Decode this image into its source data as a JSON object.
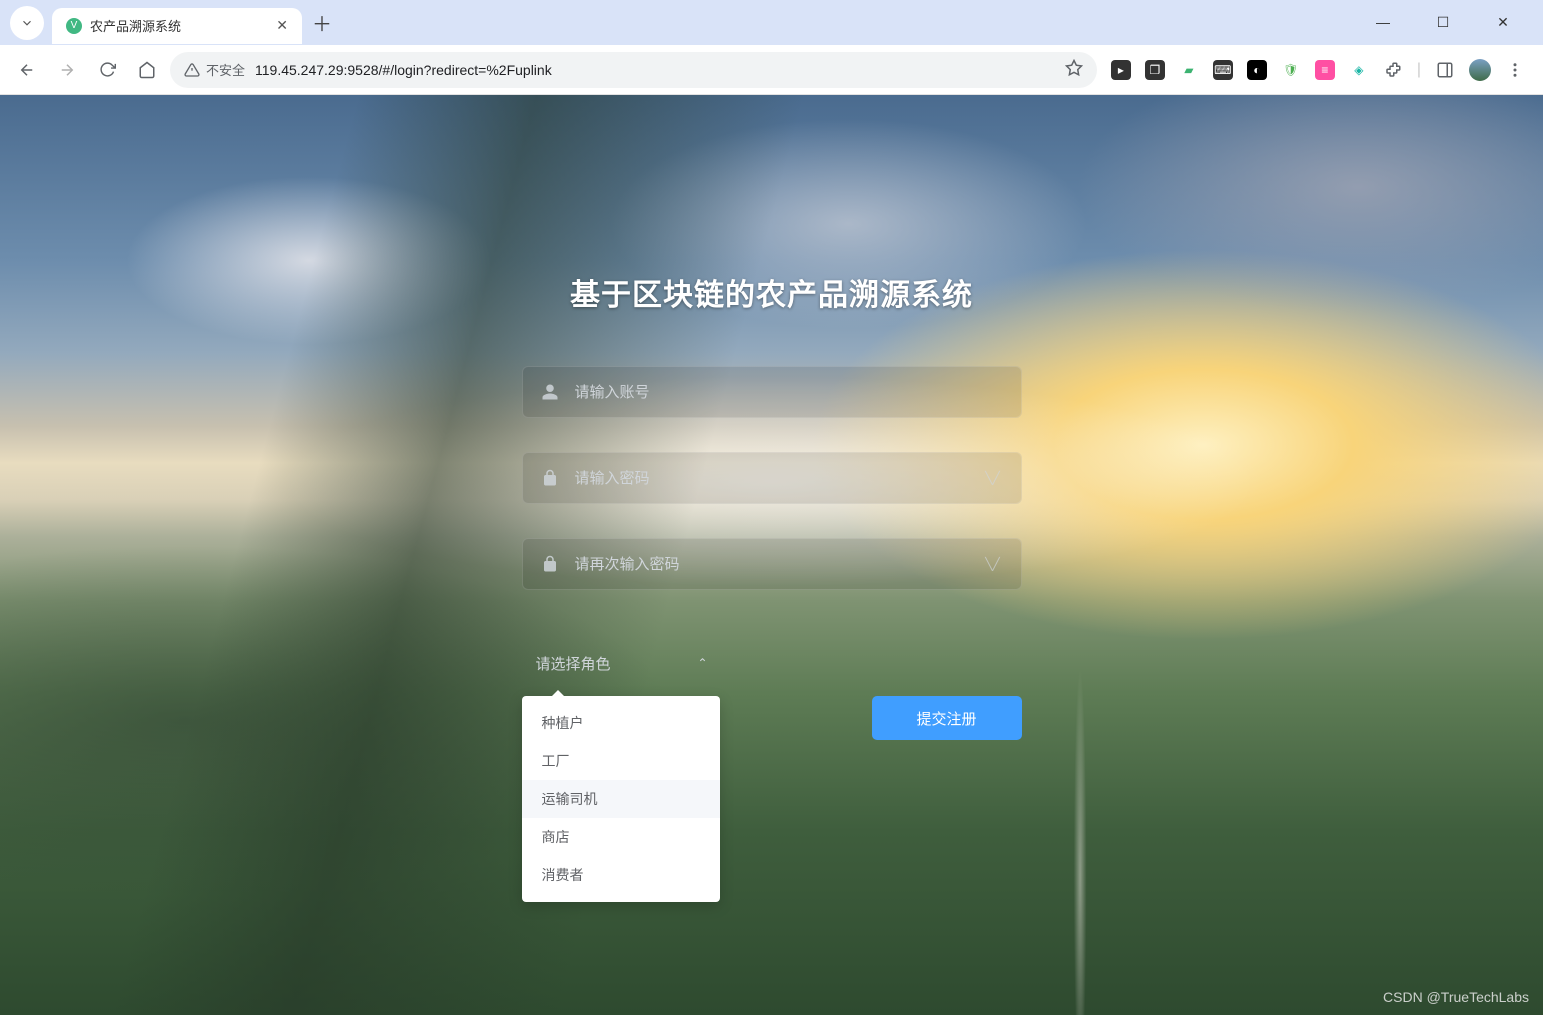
{
  "browser": {
    "tab_title": "农产品溯源系统",
    "insecure_label": "不安全",
    "url": "119.45.247.29:9528/#/login?redirect=%2Fuplink"
  },
  "page": {
    "title": "基于区块链的农产品溯源系统",
    "fields": {
      "account_placeholder": "请输入账号",
      "password_placeholder": "请输入密码",
      "confirm_placeholder": "请再次输入密码"
    },
    "role_select": {
      "placeholder": "请选择角色",
      "options": [
        "种植户",
        "工厂",
        "运输司机",
        "商店",
        "消费者"
      ],
      "highlighted_index": 2
    },
    "submit_label": "提交注册",
    "watermark": "CSDN @TrueTechLabs"
  }
}
